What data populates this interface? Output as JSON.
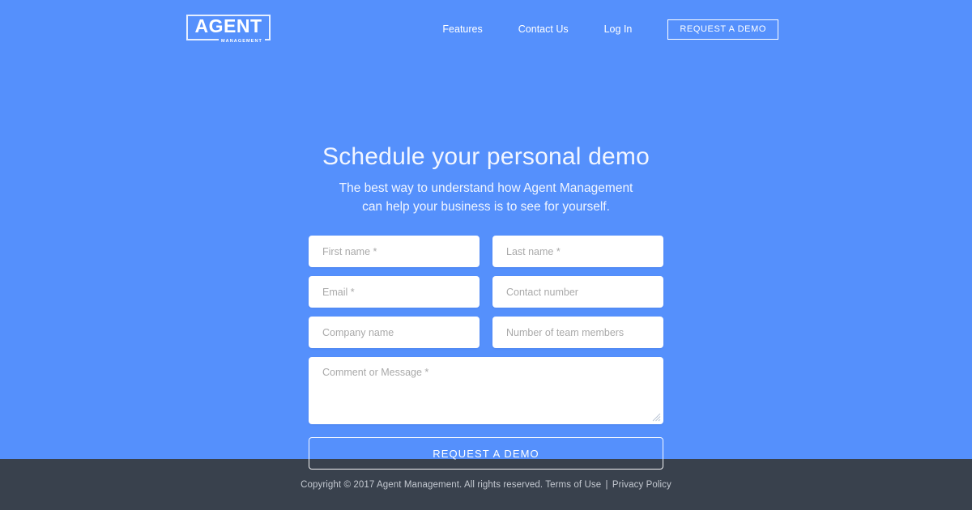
{
  "theme": {
    "background": "#5590fc",
    "footer_background": "#39414d",
    "field_background": "#ffffff",
    "text_on_blue": "#ffffff",
    "placeholder": "#a9a9a9",
    "footer_text": "#c3c8d0"
  },
  "header": {
    "logo": {
      "word": "AGENT",
      "sub": "MANAGEMENT"
    },
    "nav": [
      {
        "label": "Features"
      },
      {
        "label": "Contact Us"
      },
      {
        "label": "Log In"
      }
    ],
    "cta_label": "REQUEST A DEMO"
  },
  "hero": {
    "title": "Schedule your personal demo",
    "subtitle_line1": "The best way to understand how Agent Management",
    "subtitle_line2": "can help your business is to see for yourself."
  },
  "form": {
    "fields": {
      "first_name": {
        "placeholder": "First name *",
        "value": ""
      },
      "last_name": {
        "placeholder": "Last name *",
        "value": ""
      },
      "email": {
        "placeholder": "Email *",
        "value": ""
      },
      "contact_number": {
        "placeholder": "Contact number",
        "value": ""
      },
      "company_name": {
        "placeholder": "Company name",
        "value": ""
      },
      "team_members": {
        "placeholder": "Number of team members",
        "value": ""
      },
      "message": {
        "placeholder": "Comment or Message *",
        "value": ""
      }
    },
    "submit_label": "REQUEST A DEMO"
  },
  "footer": {
    "copyright": "Copyright © 2017 Agent Management. All rights reserved.",
    "terms_label": "Terms of Use",
    "separator": "|",
    "privacy_label": "Privacy Policy"
  }
}
